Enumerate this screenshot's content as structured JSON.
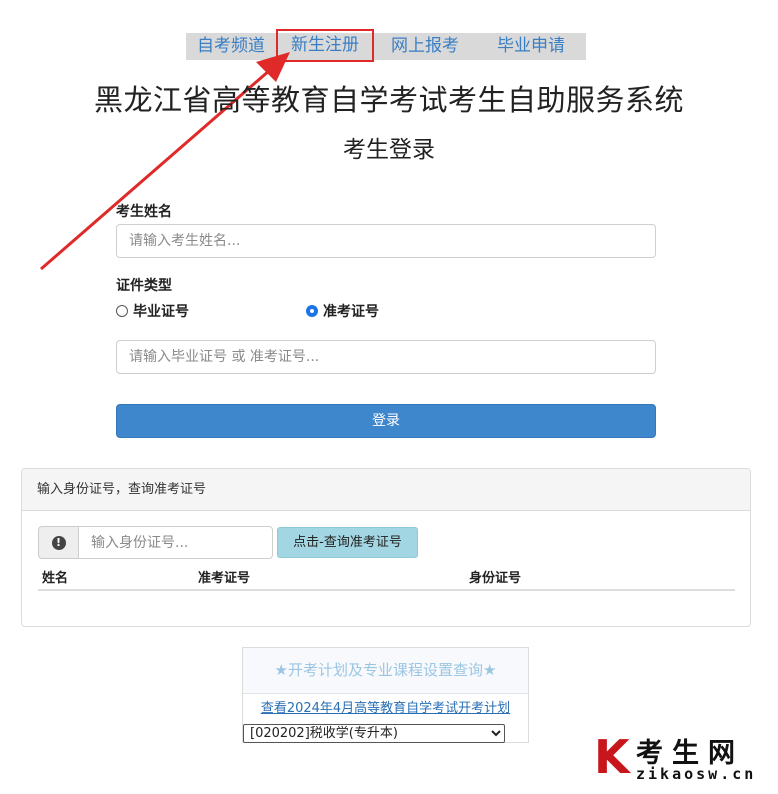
{
  "nav": {
    "items": [
      "自考频道",
      "新生注册",
      "网上报考",
      "毕业申请"
    ],
    "highlight_color": "#e02a2a"
  },
  "header": {
    "system_title": "黑龙江省高等教育自学考试考生自助服务系统",
    "login_title": "考生登录"
  },
  "form": {
    "name_label": "考生姓名",
    "name_placeholder": "请输入考生姓名...",
    "id_type_label": "证件类型",
    "radio_graduation": "毕业证号",
    "radio_admission": "准考证号",
    "selected_radio": "准考证号",
    "cert_placeholder": "请输入毕业证号 或 准考证号...",
    "login_button": "登录",
    "accent_color": "#3f87cd"
  },
  "lookup": {
    "panel_title": "输入身份证号，查询准考证号",
    "id_placeholder": "输入身份证号...",
    "query_button": "点击-查询准考证号",
    "columns": [
      "姓名",
      "准考证号",
      "身份证号"
    ]
  },
  "plan": {
    "title": "★开考计划及专业课程设置查询★",
    "link_text": "查看2024年4月高等教育自学考试开考计划",
    "selected_major": "[020202]税收学(专升本)"
  },
  "watermark": {
    "logo_letter": "K",
    "name": "考生网",
    "url": "zikaosw.cn"
  }
}
